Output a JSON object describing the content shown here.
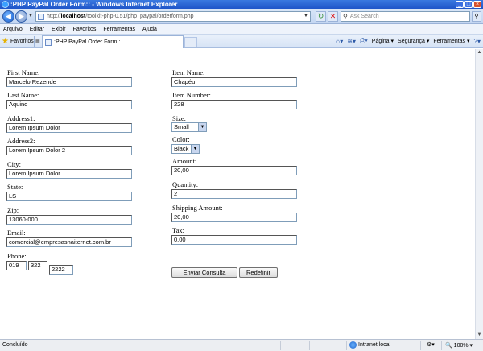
{
  "window": {
    "title": ":PHP PayPal Order Form:: - Windows Internet Explorer"
  },
  "address_bar": {
    "url_prefix": "http://",
    "url_host": "localhost",
    "url_path": "/toolkit-php-0.51/php_paypal/orderform.php",
    "search_placeholder": "Ask Search"
  },
  "menu": {
    "items": [
      "Arquivo",
      "Editar",
      "Exibir",
      "Favoritos",
      "Ferramentas",
      "Ajuda"
    ]
  },
  "tabs": {
    "favorites_label": "Favoritos",
    "active_tab_title": ":PHP PayPal Order Form::"
  },
  "command_bar": {
    "page": "Página",
    "security": "Segurança",
    "tools": "Ferramentas"
  },
  "form": {
    "left": {
      "first_name": {
        "label": "First Name:",
        "value": "Marcelo Rezende"
      },
      "last_name": {
        "label": "Last Name:",
        "value": "Aquino"
      },
      "address1": {
        "label": "Address1:",
        "value": "Lorem Ipsum Dolor"
      },
      "address2": {
        "label": "Address2:",
        "value": "Lorem Ipsum Dolor 2"
      },
      "city": {
        "label": "City:",
        "value": "Lorem Ipsum Dolor"
      },
      "state": {
        "label": "State:",
        "value": "LS"
      },
      "zip": {
        "label": "Zip:",
        "value": "13060-000"
      },
      "email": {
        "label": "Email:",
        "value": "comercial@empresasnaiternet.com.br"
      },
      "phone": {
        "label": "Phone:",
        "area": "019",
        "prefix": "322",
        "line": "2222",
        "sep1": "-",
        "sep2": "-"
      }
    },
    "right": {
      "item_name": {
        "label": "Item Name:",
        "value": "Chapéu"
      },
      "item_number": {
        "label": "Item Number:",
        "value": "228"
      },
      "size": {
        "label": "Size:",
        "value": "Small"
      },
      "color": {
        "label": "Color:",
        "value": "Black"
      },
      "amount": {
        "label": "Amount:",
        "value": "20,00"
      },
      "quantity": {
        "label": "Quantity:",
        "value": "2"
      },
      "shipping_amount": {
        "label": "Shipping Amount:",
        "value": "20,00"
      },
      "tax": {
        "label": "Tax:",
        "value": "0,00"
      }
    },
    "buttons": {
      "submit": "Enviar Consulta",
      "reset": "Redefinir"
    }
  },
  "status_bar": {
    "status": "Concluído",
    "zone": "Intranet local",
    "zoom": "100%"
  }
}
